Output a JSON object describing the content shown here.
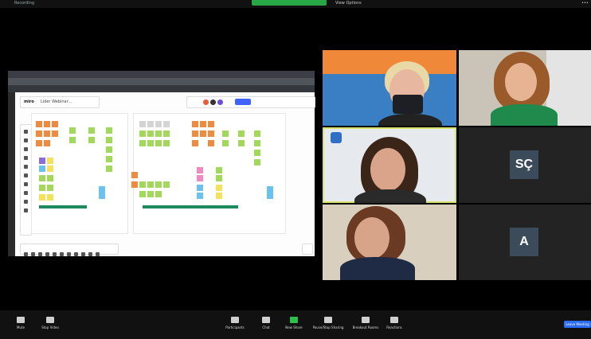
{
  "top_bar": {
    "recording_label": "Recording",
    "speaker_label": "View Options"
  },
  "miro": {
    "logo": "miro",
    "board_title": "Lider Webinar..."
  },
  "participants": [
    {
      "id": "p1",
      "name": ""
    },
    {
      "id": "p2",
      "name": ""
    },
    {
      "id": "p3",
      "name": ""
    },
    {
      "id": "p4",
      "initials": "SÇ",
      "name": ""
    },
    {
      "id": "p5",
      "name": ""
    },
    {
      "id": "p6",
      "initials": "A",
      "name": ""
    }
  ],
  "bottom_bar": {
    "controls": [
      {
        "key": "mute",
        "label": "Mute",
        "icon": "microphone-icon"
      },
      {
        "key": "video",
        "label": "Stop Video",
        "icon": "video-camera-icon"
      },
      {
        "key": "participants",
        "label": "Participants",
        "icon": "people-icon"
      },
      {
        "key": "chat",
        "label": "Chat",
        "icon": "chat-icon"
      },
      {
        "key": "share",
        "label": "New Share",
        "icon": "share-screen-icon"
      },
      {
        "key": "pause",
        "label": "Pause/Stop Sharing",
        "icon": "pause-icon"
      },
      {
        "key": "rooms",
        "label": "Breakout Rooms",
        "icon": "grid-icon"
      },
      {
        "key": "reactions",
        "label": "Reactions",
        "icon": "smile-icon"
      }
    ],
    "end_label": "Leave Meeting"
  },
  "colors": {
    "share_banner": "#27a844",
    "active_speaker": "#d9e26a",
    "end_button": "#2d6cf6"
  }
}
